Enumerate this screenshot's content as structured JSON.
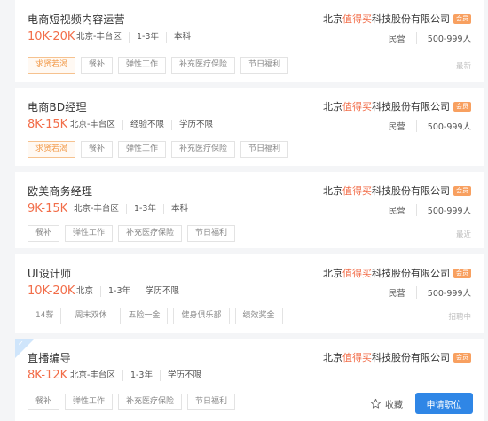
{
  "jobs": [
    {
      "title": "电商短视频内容运营",
      "salary": "10K-20K",
      "requirements": [
        "北京-丰台区",
        "1-3年",
        "本科"
      ],
      "company_prefix": "北京",
      "company_highlight": "值得买",
      "company_suffix": "科技股份有限公司",
      "vip": "会员",
      "company_type": "民营",
      "company_size": "500-999人",
      "tags": [
        "求贤若渴",
        "餐补",
        "弹性工作",
        "补充医疗保险",
        "节日福利"
      ],
      "status": "最新"
    },
    {
      "title": "电商BD经理",
      "salary": "8K-15K",
      "requirements": [
        "北京-丰台区",
        "经验不限",
        "学历不限"
      ],
      "company_prefix": "北京",
      "company_highlight": "值得买",
      "company_suffix": "科技股份有限公司",
      "vip": "会员",
      "company_type": "民营",
      "company_size": "500-999人",
      "tags": [
        "求贤若渴",
        "餐补",
        "弹性工作",
        "补充医疗保险",
        "节日福利"
      ],
      "status": ""
    },
    {
      "title": "欧美商务经理",
      "salary": "9K-15K",
      "requirements": [
        "北京-丰台区",
        "1-3年",
        "本科"
      ],
      "company_prefix": "北京",
      "company_highlight": "值得买",
      "company_suffix": "科技股份有限公司",
      "vip": "会员",
      "company_type": "民营",
      "company_size": "500-999人",
      "tags": [
        "餐补",
        "弹性工作",
        "补充医疗保险",
        "节日福利"
      ],
      "status": "最近"
    },
    {
      "title": "UI设计师",
      "salary": "10K-20K",
      "requirements": [
        "北京",
        "1-3年",
        "学历不限"
      ],
      "company_prefix": "北京",
      "company_highlight": "值得买",
      "company_suffix": "科技股份有限公司",
      "vip": "会员",
      "company_type": "民营",
      "company_size": "500-999人",
      "tags": [
        "14薪",
        "周末双休",
        "五险一金",
        "健身俱乐部",
        "绩效奖金"
      ],
      "status": "招聘中"
    },
    {
      "title": "直播编导",
      "salary": "8K-12K",
      "requirements": [
        "北京-丰台区",
        "1-3年",
        "学历不限"
      ],
      "company_prefix": "北京",
      "company_highlight": "值得买",
      "company_suffix": "科技股份有限公司",
      "vip": "会员",
      "tags": [
        "餐补",
        "弹性工作",
        "补充医疗保险",
        "节日福利"
      ],
      "collect_label": "收藏",
      "apply_label": "申请职位"
    }
  ],
  "colors": {
    "salary": "#f26d49",
    "highlight": "#f26d49",
    "apply_button": "#2f86e6",
    "hot_tag": "#f29a4a"
  },
  "icons": {
    "collect": "star-outline-icon",
    "corner": "new-badge-corner"
  }
}
